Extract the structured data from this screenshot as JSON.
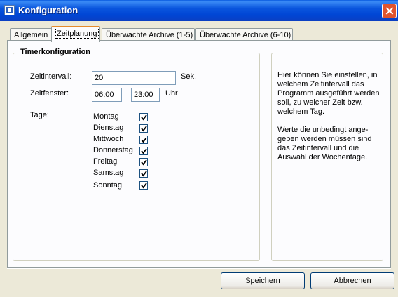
{
  "window": {
    "title": "Konfiguration"
  },
  "tabs": [
    {
      "label": "Allgemein"
    },
    {
      "label": "Zeitplanung",
      "active": true
    },
    {
      "label": "Überwachte Archive (1-5)"
    },
    {
      "label": "Überwachte Archive (6-10)"
    }
  ],
  "timer": {
    "group_title": "Timerkonfiguration",
    "interval_label": "Zeitintervall:",
    "interval_value": "20",
    "interval_unit": "Sek.",
    "window_label": "Zeitfenster:",
    "window_from": "06:00",
    "window_to": "23:00",
    "window_unit": "Uhr",
    "days_label": "Tage:",
    "days": [
      {
        "label": "Montag",
        "checked": true
      },
      {
        "label": "Dienstag",
        "checked": true
      },
      {
        "label": "Mittwoch",
        "checked": true
      },
      {
        "label": "Donnerstag",
        "checked": true
      },
      {
        "label": "Freitag",
        "checked": true
      },
      {
        "label": "Samstag",
        "checked": true
      },
      {
        "label": "Sonntag",
        "checked": true
      }
    ]
  },
  "help": {
    "paragraph1": "Hier können Sie einstellen, in welchem Zeitintervall das Programm ausgeführt werden soll, zu welcher Zeit bzw. welchem Tag.",
    "paragraph2": "Werte die unbedingt ange-geben werden müssen sind das Zeitintervall und die Auswahl der Wochentage."
  },
  "buttons": {
    "save": "Speichern",
    "cancel": "Abbrechen"
  },
  "icons": {
    "app": "app-icon",
    "close": "close-icon",
    "check": "checkmark-icon"
  }
}
